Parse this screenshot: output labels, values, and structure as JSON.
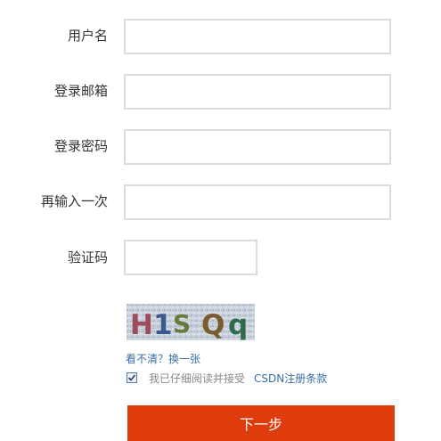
{
  "form": {
    "fields": [
      {
        "name": "username",
        "label": "用户名",
        "value": ""
      },
      {
        "name": "email",
        "label": "登录邮箱",
        "value": ""
      },
      {
        "name": "password",
        "label": "登录密码",
        "value": ""
      },
      {
        "name": "password-confirm",
        "label": "再输入一次",
        "value": ""
      },
      {
        "name": "captcha",
        "label": "验证码",
        "value": ""
      }
    ],
    "captcha_image_text": "H1S Qq",
    "refresh_link": "看不清？换一张",
    "agree_checked": true,
    "agree_text": "我已仔细阅读并接受",
    "terms_link": "CSDN注册条款",
    "next_button": "下一步",
    "colors": {
      "button_bg": "#df3c0d",
      "link": "#3a6ea5",
      "input_border": "#dcdcdc"
    }
  }
}
